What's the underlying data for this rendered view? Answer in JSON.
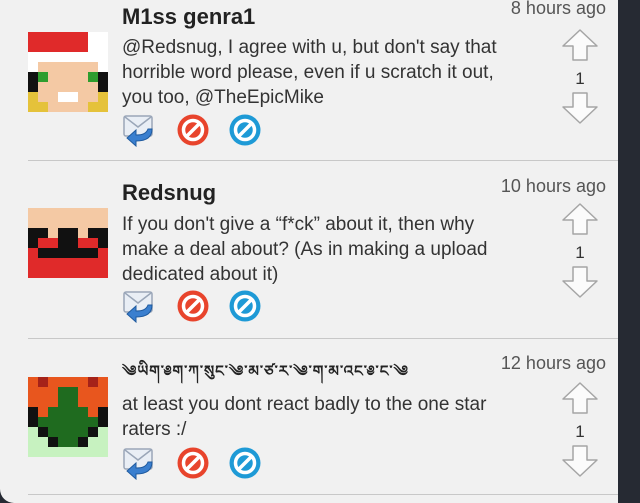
{
  "comments": [
    {
      "username": "M1ss genra1",
      "time": "8 hours ago",
      "text": "@Redsnug, I agree with u, but don't say that horrible word please, even if u scratch it out, you too, @TheEpicMike",
      "votes": "1"
    },
    {
      "username": "Redsnug",
      "time": "10 hours ago",
      "text": "If you don't give a “f*ck” about it, then why make a deal about? (As in making a upload dedicated about it)",
      "votes": "1"
    },
    {
      "username": "༄ཡིག་༅ག་ཀ་སུང་༄་མ་ཙ་ར་༄་ག་མ་འང་༅་ང་༄",
      "time": "12 hours ago",
      "text": "at least you dont react badly to the one star raters :/",
      "votes": "1"
    }
  ],
  "icons": {
    "reply": "reply-icon",
    "flag": "flag-icon",
    "block": "block-icon",
    "up": "thumb-up-arrow-icon",
    "down": "thumb-down-arrow-icon"
  },
  "colors": {
    "flag": "#e8442c",
    "block": "#1e9ad6",
    "reply": "#3a7fcf"
  }
}
